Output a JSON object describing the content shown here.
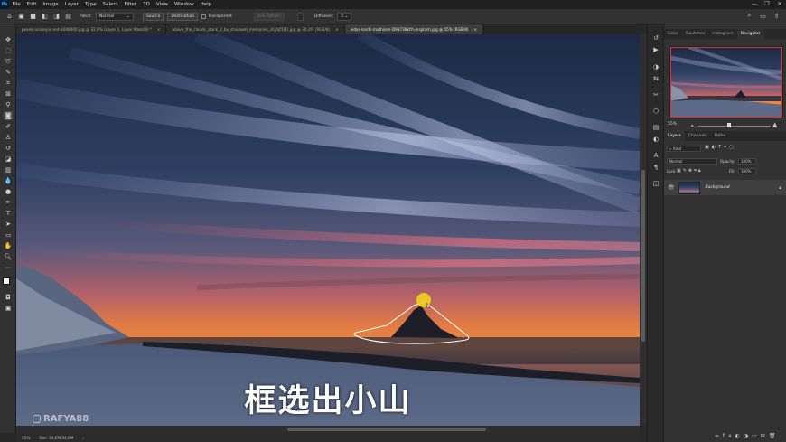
{
  "app": {
    "logo": "Ps"
  },
  "menu": [
    "File",
    "Edit",
    "Image",
    "Layer",
    "Type",
    "Select",
    "Filter",
    "3D",
    "View",
    "Window",
    "Help"
  ],
  "window_controls": [
    "—",
    "❐",
    "✕"
  ],
  "options": {
    "patch_label": "Patch:",
    "patch_value": "Normal",
    "source_label": "Source",
    "destination_label": "Destination",
    "transparent_label": "Transparent",
    "use_pattern_label": "Use Pattern",
    "diffusion_label": "Diffusion:",
    "diffusion_value": "5"
  },
  "tabs": [
    {
      "label": "pexels-visionpic-net-1008000.jpg @ 32,8% (Layer 1, Layer Mask/8) *",
      "close": "×"
    },
    {
      "label": "above_the_clouds_stock_2_by_shairwell_memories_d1jfqf1(1).jpg @ 30,3% (RGB/8)",
      "close": "×"
    },
    {
      "label": "vidar-nordli-mathisen-D98736ktY-unsplash.jpg @ 55% (RGB/8)",
      "close": "×"
    }
  ],
  "canvas": {
    "caption": "框选出小山",
    "watermark": "RAFYA88"
  },
  "status": {
    "zoom": "55%",
    "doc": "Doc: 34,6M/34,6M",
    "arrow": "›"
  },
  "panels": {
    "top_tabs": [
      "Color",
      "Swatches",
      "Histogram",
      "Navigator"
    ],
    "nav_zoom": "55%",
    "layer_tabs": [
      "Layers",
      "Channels",
      "Paths"
    ],
    "kind_label": "Kind",
    "blend_mode": "Normal",
    "opacity_label": "Opacity:",
    "opacity_value": "100%",
    "lock_label": "Lock:",
    "fill_label": "Fill:",
    "fill_value": "100%",
    "layer_name": "Background"
  },
  "colors": {
    "accent": "#31a8ff",
    "nav_frame": "#e03030",
    "selection": "#ffffff"
  }
}
